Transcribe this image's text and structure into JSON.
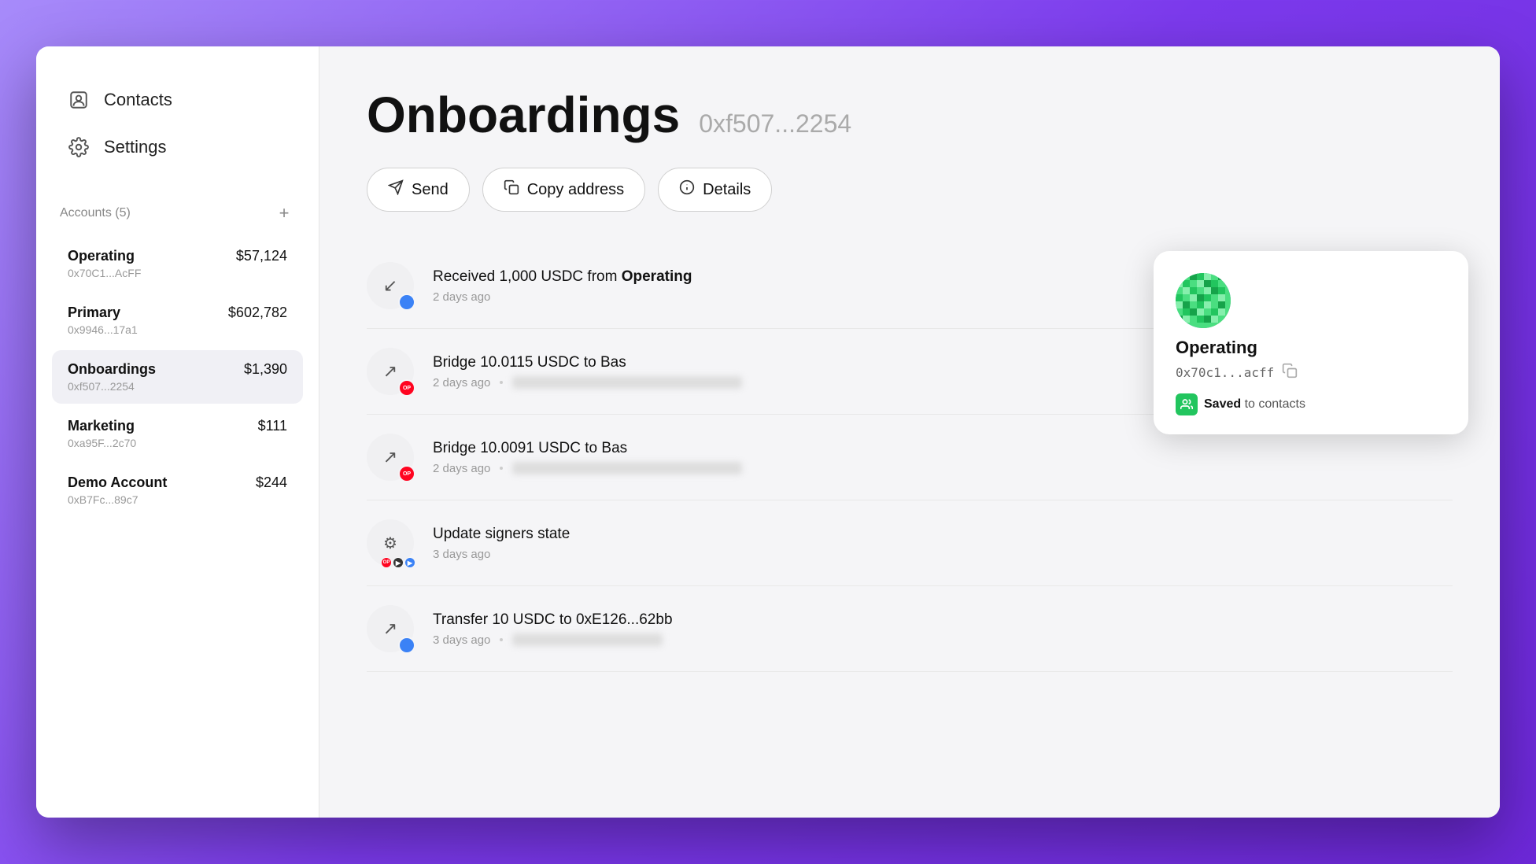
{
  "sidebar": {
    "nav_items": [
      {
        "id": "contacts",
        "label": "Contacts",
        "icon": "👤"
      },
      {
        "id": "settings",
        "label": "Settings",
        "icon": "⚙️"
      }
    ],
    "accounts_section": {
      "title": "Accounts (5)",
      "add_label": "+",
      "accounts": [
        {
          "id": "operating",
          "name": "Operating",
          "balance": "$57,124",
          "address": "0x70C1...AcFF",
          "active": false
        },
        {
          "id": "primary",
          "name": "Primary",
          "balance": "$602,782",
          "address": "0x9946...17a1",
          "active": false
        },
        {
          "id": "onboardings",
          "name": "Onboardings",
          "balance": "$1,390",
          "address": "0xf507...2254",
          "active": true
        },
        {
          "id": "marketing",
          "name": "Marketing",
          "balance": "$111",
          "address": "0xa95F...2c70",
          "active": false
        },
        {
          "id": "demo",
          "name": "Demo Account",
          "balance": "$244",
          "address": "0xB7Fc...89c7",
          "active": false
        }
      ]
    }
  },
  "main": {
    "page_title": "Onboardings",
    "page_address": "0xf507...2254",
    "action_buttons": [
      {
        "id": "send",
        "label": "Send",
        "icon": "➤"
      },
      {
        "id": "copy-address",
        "label": "Copy address",
        "icon": "⎘"
      },
      {
        "id": "details",
        "label": "Details",
        "icon": "ℹ"
      }
    ],
    "transactions": [
      {
        "id": "tx1",
        "icon_type": "receive",
        "icon_symbol": "↙",
        "badge_type": "blue",
        "badge_label": "",
        "title": "Received 1,000 USDC from",
        "title_highlight": "Operating",
        "time": "2 days ago",
        "hash_blur": "████ █████████ ██",
        "has_popup": true
      },
      {
        "id": "tx2",
        "icon_type": "send",
        "icon_symbol": "↗",
        "badge_type": "op",
        "badge_label": "OP",
        "title": "Bridge 10.0115 USDC to Bas",
        "title_highlight": "",
        "time": "2 days ago",
        "hash_blur": "████ █████████ ████████ ██",
        "has_popup": false
      },
      {
        "id": "tx3",
        "icon_type": "send",
        "icon_symbol": "↗",
        "badge_type": "op",
        "badge_label": "OP",
        "title": "Bridge 10.0091 USDC to Bas",
        "title_highlight": "",
        "time": "2 days ago",
        "hash_blur": "████ █████████ ████████ ██",
        "has_popup": false
      },
      {
        "id": "tx4",
        "icon_type": "gear",
        "icon_symbol": "⚙",
        "badge_type": "multi",
        "badge_label": "",
        "title": "Update signers state",
        "title_highlight": "",
        "time": "3 days ago",
        "hash_blur": "",
        "has_popup": false
      },
      {
        "id": "tx5",
        "icon_type": "send",
        "icon_symbol": "↗",
        "badge_type": "blue",
        "badge_label": "",
        "title": "Transfer 10 USDC to 0xE126...62bb",
        "title_highlight": "",
        "time": "3 days ago",
        "hash_blur": "████ █████████ ██",
        "has_popup": false
      }
    ],
    "popup": {
      "name": "Operating",
      "address": "0x70c1...acff",
      "saved_label": "Saved",
      "saved_suffix": "to contacts"
    }
  }
}
